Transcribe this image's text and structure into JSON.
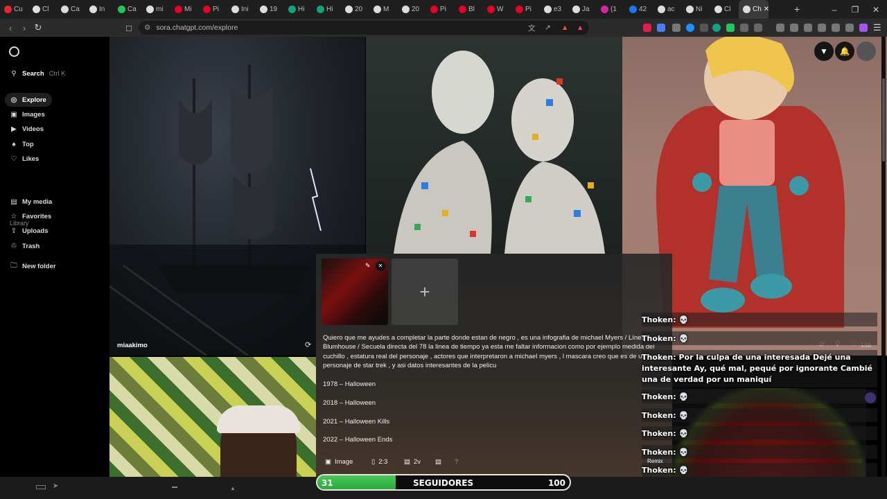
{
  "browser": {
    "tabs": [
      {
        "label": "Cu",
        "color": "#e23"
      },
      {
        "label": "Cl",
        "color": "#ddd"
      },
      {
        "label": "Ca",
        "color": "#ddd"
      },
      {
        "label": "In",
        "color": "#ddd"
      },
      {
        "label": "Ca",
        "color": "#22c55e"
      },
      {
        "label": "mi",
        "color": "#ddd"
      },
      {
        "label": "Mi",
        "color": "#e60023"
      },
      {
        "label": "Pi",
        "color": "#e60023"
      },
      {
        "label": "Ini",
        "color": "#ddd"
      },
      {
        "label": "19",
        "color": "#ddd"
      },
      {
        "label": "Hi",
        "color": "#10a37f"
      },
      {
        "label": "Hi",
        "color": "#10a37f"
      },
      {
        "label": "20",
        "color": "#ddd"
      },
      {
        "label": "M",
        "color": "#ddd"
      },
      {
        "label": "20",
        "color": "#ddd"
      },
      {
        "label": "Pi",
        "color": "#e60023"
      },
      {
        "label": "Bl",
        "color": "#e60023"
      },
      {
        "label": "W",
        "color": "#e60023"
      },
      {
        "label": "Pi",
        "color": "#e60023"
      },
      {
        "label": "e3",
        "color": "#ddd"
      },
      {
        "label": "Ja",
        "color": "#ddd"
      },
      {
        "label": "(1",
        "color": "#d6249f"
      },
      {
        "label": "42",
        "color": "#1877f2"
      },
      {
        "label": "ac",
        "color": "#ddd"
      },
      {
        "label": "Ni",
        "color": "#ddd"
      },
      {
        "label": "Cl",
        "color": "#ddd"
      },
      {
        "label": "Ch",
        "color": "#ddd"
      }
    ],
    "url": "sora.chatgpt.com/explore"
  },
  "sidebar": {
    "search_label": "Search",
    "search_shortcut": "Ctrl K",
    "nav": [
      {
        "label": "Explore",
        "icon": "compass-icon"
      },
      {
        "label": "Images",
        "icon": "image-icon"
      },
      {
        "label": "Videos",
        "icon": "video-icon"
      },
      {
        "label": "Top",
        "icon": "trophy-icon"
      },
      {
        "label": "Likes",
        "icon": "heart-icon"
      }
    ],
    "library_title": "Library",
    "library": [
      {
        "label": "My media",
        "icon": "media-icon"
      },
      {
        "label": "Favorites",
        "icon": "star-icon"
      },
      {
        "label": "Uploads",
        "icon": "upload-icon"
      },
      {
        "label": "Trash",
        "icon": "trash-icon"
      }
    ],
    "new_folder": "New folder"
  },
  "gallery": {
    "ship_author": "miaakimo",
    "like_count": "158"
  },
  "composer": {
    "prompt": "Quiero que me ayudes a completar la parte donde estan de negro , es una infografia de michael Myers / Línea Blumhouse / Secuela directa del 78 la linea de tiempo ya esta me faltar informacion como por ejemplo medida del cuchillo , estatura real del personaje , actores que interpretaron a michael myers , l mascara creo que es de un personaje de star trek , y asi datos interesantes de la pelicu",
    "timeline": [
      "1978 – Halloween",
      "2018 – Halloween",
      "2021 – Halloween Kills",
      "2022 – Halloween Ends"
    ],
    "type_label": "Image",
    "ratio_label": "2:3",
    "variations_label": "2v",
    "help_label": "?"
  },
  "chat": {
    "user": "Thoken:",
    "message": "Por la culpa de una interesada Dejé una interesante Ay, qué mal, pequé por ignorante Cambié una de verdad por un maniquí",
    "remix_label": "Remix"
  },
  "followers": {
    "current": "31",
    "label": "SEGUIDORES",
    "goal": "100",
    "progress": 0.31
  }
}
